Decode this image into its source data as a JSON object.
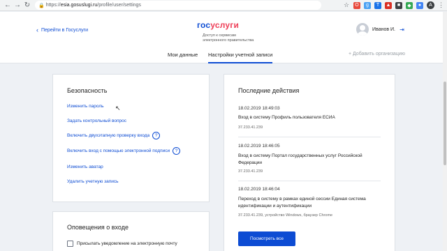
{
  "browser": {
    "url_scheme": "https://",
    "url_host": "esia.gosuslugi.ru",
    "url_path": "/profile/user/settings",
    "profile_initial": "A",
    "extensions": [
      {
        "name": "opera-icon",
        "color": "#e8483b",
        "glyph": "O"
      },
      {
        "name": "grammarly-icon",
        "color": "#4aa1f3",
        "glyph": "g"
      },
      {
        "name": "translate-icon",
        "color": "#1a73e8",
        "glyph": "T"
      },
      {
        "name": "red-ext-icon",
        "color": "#d93025",
        "glyph": "▲"
      },
      {
        "name": "dark-ext-icon",
        "color": "#3c4043",
        "glyph": "■"
      },
      {
        "name": "green-ext-icon",
        "color": "#34a853",
        "glyph": "◆"
      },
      {
        "name": "blue-ext-icon",
        "color": "#4285f4",
        "glyph": "●"
      }
    ]
  },
  "header": {
    "back_link": "Перейти в Госуслуги",
    "logo_part1": "гос",
    "logo_part2": "услуги",
    "tagline": "Доступ к сервисам электронного правительства",
    "user_name": "Иванов И.",
    "tabs": [
      "Мои данные",
      "Настройки учетной записи"
    ],
    "add_org": "+ Добавить организацию"
  },
  "security": {
    "title": "Безопасность",
    "links": [
      "Изменить пароль",
      "Задать контрольный вопрос",
      "Включить двухэтапную проверку входа",
      "Включить вход с помощью электронной подписи",
      "Изменить аватар",
      "Удалить учетную запись"
    ]
  },
  "notifications": {
    "title": "Оповещения о входе",
    "checkbox_label": "Присылать уведомление на электронную почту"
  },
  "activity": {
    "title": "Последние действия",
    "items": [
      {
        "date": "18.02.2019 18:49:03",
        "text": "Вход в систему Профиль пользователя ЕСИА",
        "ip": "37.233.41.239"
      },
      {
        "date": "18.02.2019 18:46:05",
        "text": "Вход в систему Портал государственных услуг Российской Федерации",
        "ip": "37.233.41.239"
      },
      {
        "date": "18.02.2019 18:46:04",
        "text": "Переход в систему в рамках единой сессии Единая система идентификации и аутентификации",
        "ip": "37.233.41.239, устройство Windows, браузер Chrome"
      }
    ],
    "button": "Посмотреть все"
  },
  "colors": {
    "accent": "#0d4cd3",
    "logo_red": "#ee3f58",
    "background": "#eef1f5"
  }
}
